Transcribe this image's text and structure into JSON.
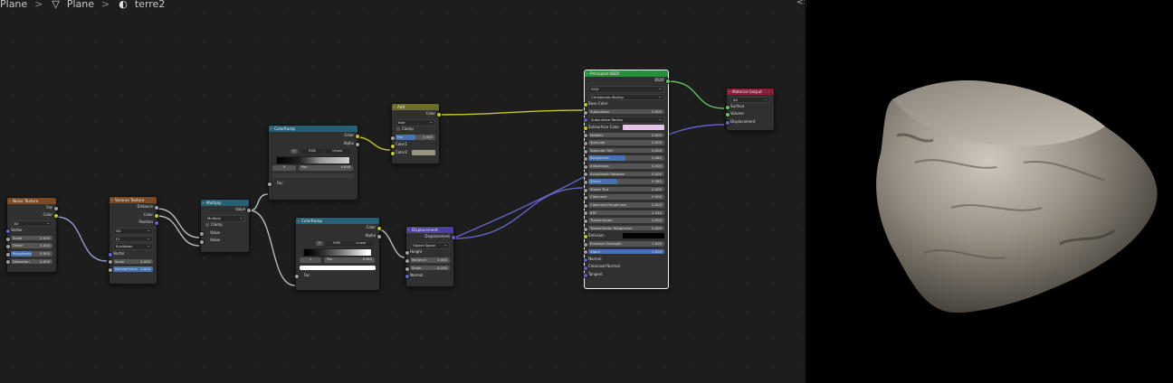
{
  "breadcrumb": {
    "items": [
      "Plane",
      "Plane",
      "terre2"
    ]
  },
  "collapse_glyph": "<>",
  "colors": {
    "socket_color": "#c7c729",
    "socket_float": "#a1a1a1",
    "socket_vector": "#6363c7",
    "socket_shader": "#63c763",
    "texture_header": "#7a4a24",
    "converter_header": "#276075",
    "shader_header": "#2e8b3a",
    "vector_header": "#4d3fa3",
    "output_header": "#8a1f3a",
    "input_header": "#6d6d2a"
  },
  "nodes": {
    "noise": {
      "title": "Noise Texture",
      "out_fac": "Fac",
      "out_color": "Color",
      "dim": "3D",
      "in_vector": "Vector",
      "scale_l": "Scale",
      "scale_v": "2.000",
      "detail_l": "Detail",
      "detail_v": "5.000",
      "rough_l": "Roughness",
      "rough_v": "0.500",
      "dist_l": "Distortion",
      "dist_v": "0.000"
    },
    "voronoi": {
      "title": "Voronoi Texture",
      "out_dist": "Distance",
      "out_color": "Color",
      "out_pos": "Position",
      "dim": "3D",
      "feature": "F1",
      "metric": "Euclidean",
      "in_vector": "Vector",
      "scale_l": "Scale",
      "scale_v": "5.000",
      "rand_l": "Randomness",
      "rand_v": "1.000"
    },
    "multiply": {
      "title": "Multiply",
      "out_value": "Value",
      "op": "Multiply",
      "clamp": "Clamp",
      "in1": "Value",
      "in2": "Value"
    },
    "ramp1": {
      "title": "ColorRamp",
      "out_color": "Color",
      "out_alpha": "Alpha",
      "mode": "RGB",
      "interp": "Linear",
      "idx": "3",
      "pos_l": "Pos",
      "pos_v": "0.638",
      "in_fac": "Fac"
    },
    "ramp2": {
      "title": "ColorRamp",
      "out_color": "Color",
      "out_alpha": "Alpha",
      "mode": "RGB",
      "interp": "Linear",
      "idx": "1",
      "pos_l": "Pos",
      "pos_v": "0.965",
      "in_fac": "Fac"
    },
    "add": {
      "title": "Add",
      "out_color": "Color",
      "op": "Add",
      "clamp": "Clamp",
      "fac_l": "Fac",
      "fac_v": "0.500",
      "in_c1": "Color1",
      "in_c2": "Color2"
    },
    "disp": {
      "title": "Displacement",
      "out": "Displacement",
      "space": "Object Space",
      "height": "Height",
      "mid_l": "Midlevel",
      "mid_v": "0.000",
      "scale_l": "Scale",
      "scale_v": "0.100",
      "normal": "Normal"
    },
    "bsdf": {
      "title": "Principled BSDF",
      "out": "BSDF",
      "dist": "GGX",
      "sss": "Christensen-Burley",
      "base_color": "Base Color",
      "fields": [
        {
          "l": "Subsurface",
          "v": "0.000",
          "f": 0
        },
        {
          "l": "Subsurface Radius",
          "v": "",
          "f": 0,
          "dd": true
        },
        {
          "l": "Subsurface Color",
          "v": "",
          "f": 0,
          "sw": "#e8c3e8"
        },
        {
          "l": "Metallic",
          "v": "0.000",
          "f": 0
        },
        {
          "l": "Specular",
          "v": "0.000",
          "f": 0
        },
        {
          "l": "Specular Tint",
          "v": "0.000",
          "f": 0
        },
        {
          "l": "Roughness",
          "v": "0.485",
          "f": 0.485
        },
        {
          "l": "Anisotropic",
          "v": "0.000",
          "f": 0
        },
        {
          "l": "Anisotropic Rotation",
          "v": "0.000",
          "f": 0
        },
        {
          "l": "Sheen",
          "v": "0.385",
          "f": 0.385
        },
        {
          "l": "Sheen Tint",
          "v": "0.000",
          "f": 0
        },
        {
          "l": "Clearcoat",
          "v": "0.000",
          "f": 0
        },
        {
          "l": "Clearcoat Roughness",
          "v": "0.000",
          "f": 0
        },
        {
          "l": "IOR",
          "v": "1.450",
          "f": 0
        },
        {
          "l": "Transmission",
          "v": "0.000",
          "f": 0
        },
        {
          "l": "Transmission Roughness",
          "v": "0.000",
          "f": 0
        }
      ],
      "emission": "Emission",
      "em_strength_l": "Emission Strength",
      "em_strength_v": "1.000",
      "alpha_l": "Alpha",
      "alpha_v": "1.000",
      "normal": "Normal",
      "cc_normal": "Clearcoat Normal",
      "tangent": "Tangent"
    },
    "output": {
      "title": "Material Output",
      "target": "All",
      "surface": "Surface",
      "volume": "Volume",
      "displacement": "Displacement"
    }
  }
}
